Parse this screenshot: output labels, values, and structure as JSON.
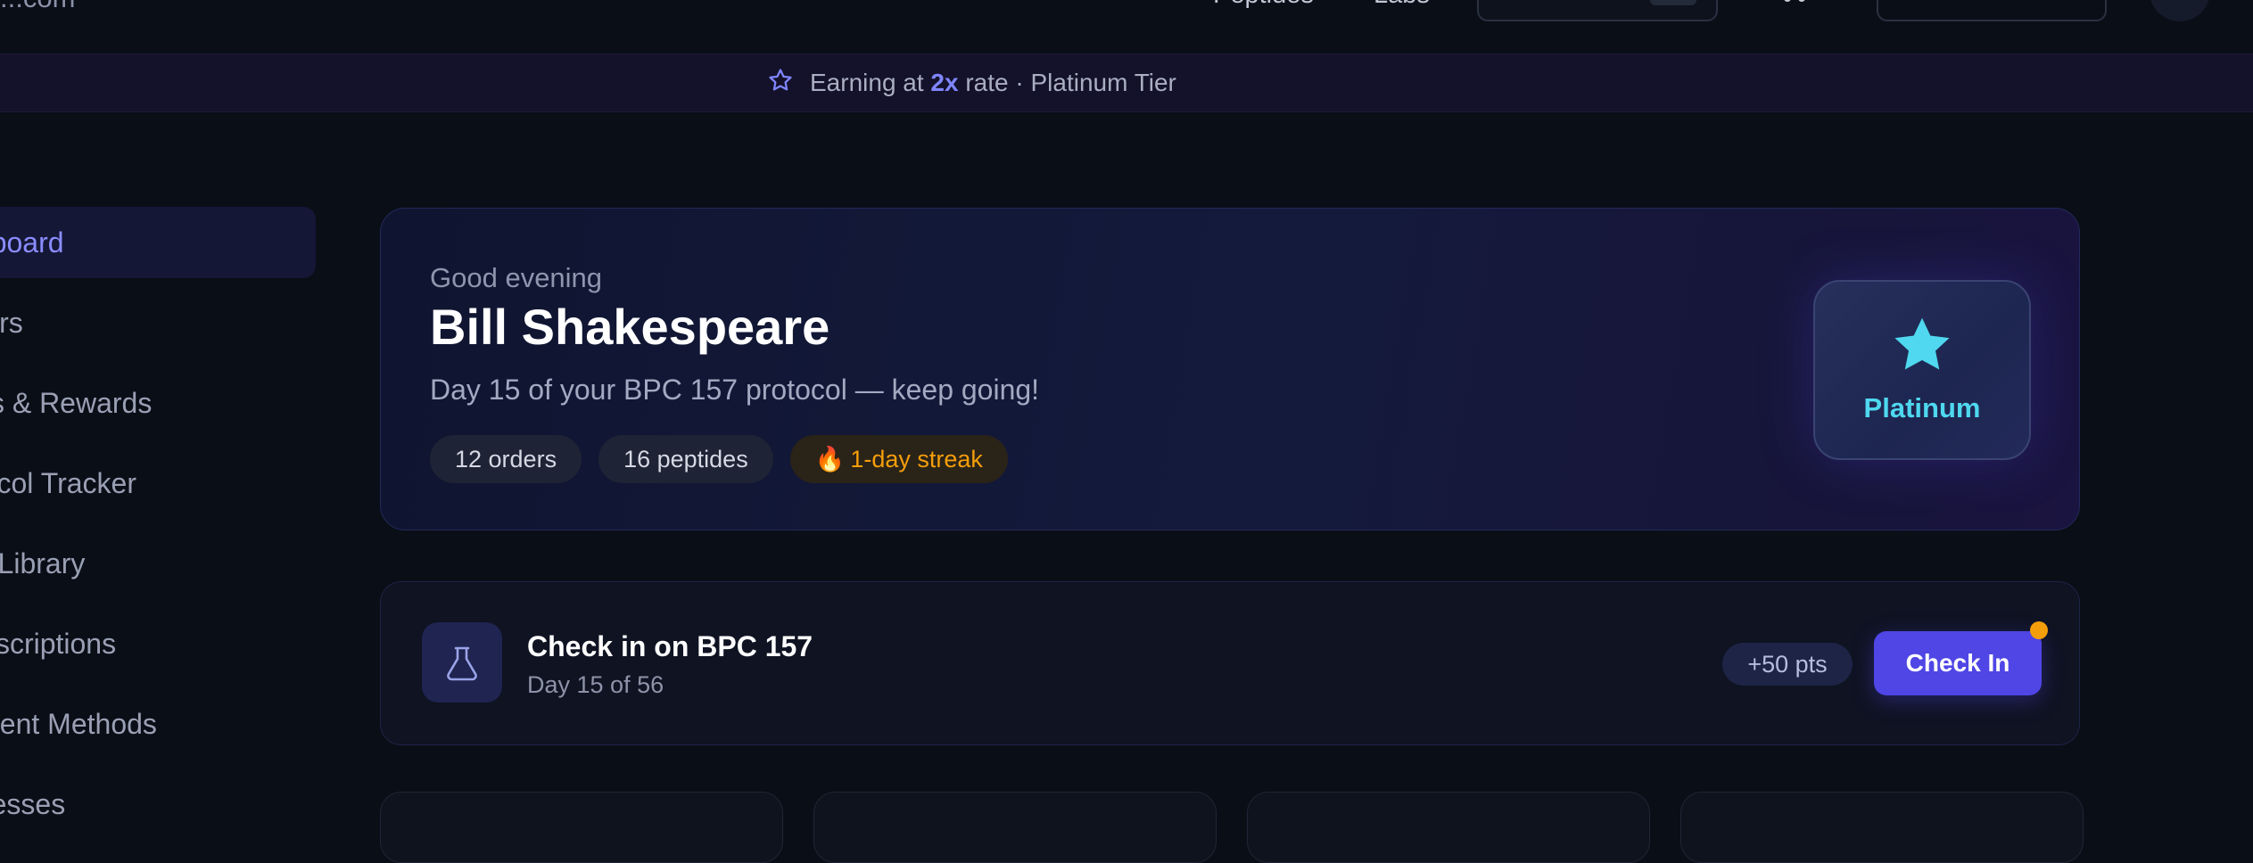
{
  "nav": {
    "logo_text": "...com",
    "links": [
      "Peptides",
      "Labs"
    ]
  },
  "banner": {
    "prefix": "Earning at",
    "multiplier": "2x",
    "suffix": "rate · Platinum Tier",
    "icon": "star-outline-icon"
  },
  "sidebar": {
    "items": [
      {
        "label": "Dashboard",
        "active": true
      },
      {
        "label": "Orders"
      },
      {
        "label": "Points & Rewards"
      },
      {
        "label": "Protocol Tracker"
      },
      {
        "label": "My Library"
      },
      {
        "label": "Subscriptions"
      },
      {
        "label": "Payment Methods"
      },
      {
        "label": "Addresses"
      }
    ]
  },
  "hero": {
    "greeting": "Good evening",
    "name": "Bill Shakespeare",
    "subtitle": "Day 15 of your BPC 157 protocol — keep going!",
    "pills": {
      "orders": "12 orders",
      "peptides": "16 peptides",
      "streak_icon": "🔥",
      "streak": "1-day streak"
    },
    "tier": {
      "label": "Platinum",
      "icon": "star-icon",
      "color": "#4fd8ef"
    }
  },
  "checkin": {
    "icon": "flask-icon",
    "title": "Check in on BPC 157",
    "subtitle": "Day 15 of 56",
    "points": "+50 pts",
    "button": "Check In"
  },
  "colors": {
    "accent": "#4f46e5",
    "accent_text": "#8a8cff",
    "streak": "#f59e0b",
    "background": "#0a0e17"
  }
}
